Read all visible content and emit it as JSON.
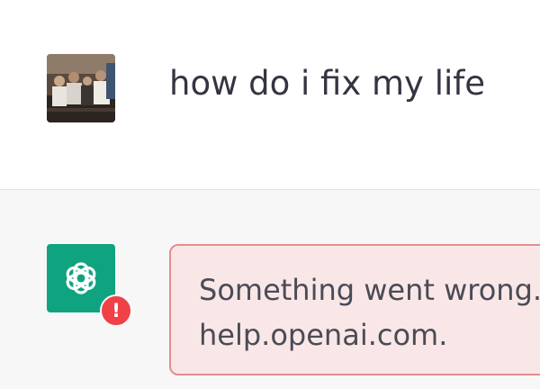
{
  "conversation": {
    "user_message": {
      "avatar": "user-photo-avatar",
      "text": "how do i fix my life"
    },
    "assistant_message": {
      "avatar": "openai-logo-icon",
      "badge": "!",
      "error_line_1": "Something went wrong.",
      "error_line_2": "help.openai.com."
    }
  },
  "colors": {
    "brand_green": "#10a37f",
    "error_red": "#ef4146",
    "error_bg": "#f9e7e8",
    "error_border": "#e58c92",
    "assistant_row_bg": "#f7f7f8",
    "text": "#343541"
  }
}
